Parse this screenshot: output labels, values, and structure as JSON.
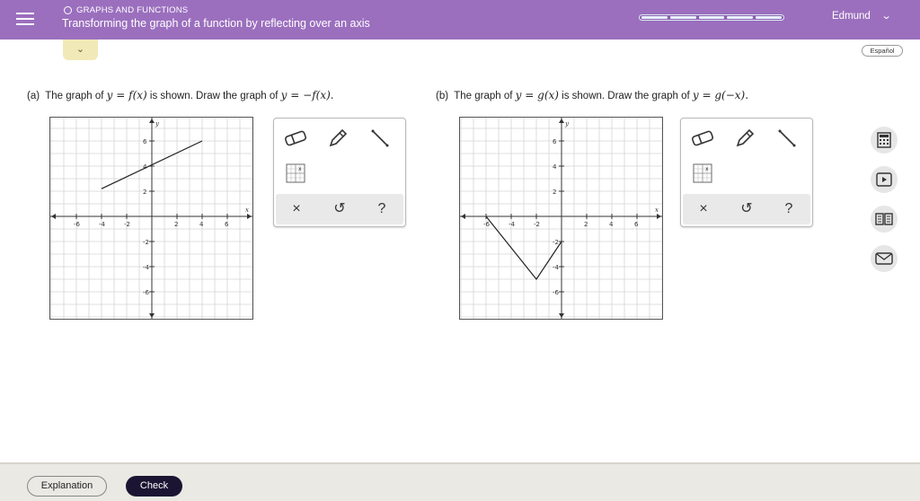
{
  "header": {
    "topic_label": "GRAPHS AND FUNCTIONS",
    "title": "Transforming the graph of a function by reflecting over an axis",
    "user_name": "Edmund",
    "progress_segments": 5,
    "menu_icon": "hamburger-menu-icon",
    "user_chevron": "chevron-down-icon",
    "colors": {
      "bar": "#9b6fbe",
      "tab": "#f2e9b8"
    }
  },
  "collapse_tab": {
    "icon": "chevron-down-icon",
    "glyph": "⌄"
  },
  "language_button": "Español",
  "problems": {
    "a": {
      "label": "(a)",
      "text_1": "The graph of",
      "eq_1": "y = f(x)",
      "text_2": "is shown. Draw the graph of",
      "eq_2": "y = −f(x)."
    },
    "b": {
      "label": "(b)",
      "text_1": "The graph of",
      "eq_1": "y = g(x)",
      "text_2": "is shown. Draw the graph of",
      "eq_2": "y = g(−x)."
    }
  },
  "graph_a": {
    "x_label": "x",
    "y_label": "y",
    "x_ticks": [
      "-6",
      "-4",
      "-2",
      "2",
      "4",
      "6"
    ],
    "y_ticks": [
      "6",
      "4",
      "2",
      "-2",
      "-4",
      "-6"
    ],
    "segment": [
      [
        -4,
        2.2
      ],
      [
        4,
        6
      ]
    ]
  },
  "graph_b": {
    "x_label": "x",
    "y_label": "y",
    "x_ticks": [
      "-6",
      "-4",
      "-2",
      "2",
      "4",
      "6"
    ],
    "y_ticks": [
      "6",
      "4",
      "2",
      "-2",
      "-4",
      "-6"
    ],
    "polyline": [
      [
        -6,
        0
      ],
      [
        -2,
        -5
      ],
      [
        0,
        -2
      ]
    ]
  },
  "toolbox": {
    "tools": [
      "eraser-icon",
      "pencil-icon",
      "line-segment-icon",
      "point-grid-icon"
    ],
    "bar": {
      "clear": "×",
      "undo": "↺",
      "help": "?"
    }
  },
  "sidebar_icons": [
    "calculator-icon",
    "video-icon",
    "textbook-icon",
    "message-icon"
  ],
  "footer": {
    "explanation": "Explanation",
    "check": "Check"
  }
}
